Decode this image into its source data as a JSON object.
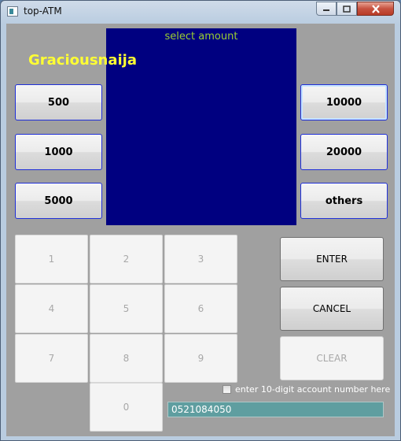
{
  "window": {
    "title": "top-ATM"
  },
  "screen": {
    "title": "select amount",
    "user_name": "Graciousnaija"
  },
  "amounts": {
    "left": [
      {
        "label": "500"
      },
      {
        "label": "1000"
      },
      {
        "label": "5000"
      }
    ],
    "right": [
      {
        "label": "10000"
      },
      {
        "label": "20000"
      },
      {
        "label": "others"
      }
    ]
  },
  "keypad": {
    "keys": [
      "1",
      "2",
      "3",
      "4",
      "5",
      "6",
      "7",
      "8",
      "9",
      "0"
    ]
  },
  "actions": {
    "enter": "ENTER",
    "cancel": "CANCEL",
    "clear": "CLEAR"
  },
  "account": {
    "checkbox_label": "enter 10-digit account number here",
    "checked": false,
    "value": "0521084050"
  },
  "colors": {
    "screen_bg": "#000080",
    "screen_title": "#9acd32",
    "user_name": "#ffff33",
    "account_bg": "#5f9ea0",
    "window_bg": "#a0a0a0"
  }
}
